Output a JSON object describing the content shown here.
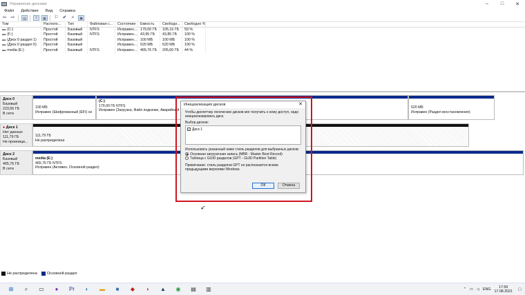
{
  "window": {
    "title": "Управление дисками"
  },
  "menu": [
    "Файл",
    "Действие",
    "Вид",
    "Справка"
  ],
  "volumes": {
    "columns": [
      "Том",
      "Располо...",
      "Тип",
      "Файловая с...",
      "Состояние",
      "Емкость",
      "Свободн...",
      "Свободно %"
    ],
    "rows": [
      [
        "(C:)",
        "Простой",
        "Базовый",
        "NTFS",
        "Исправен...",
        "179,00 ГБ",
        "105,16 ГБ",
        "59 %"
      ],
      [
        "(F:)",
        "Простой",
        "Базовый",
        "NTFS",
        "Исправен...",
        "43,95 ГБ",
        "43,85 ГБ",
        "100 %"
      ],
      [
        "(Диск 0 раздел 1)",
        "Простой",
        "Базовый",
        "",
        "Исправен...",
        "100 МБ",
        "100 МБ",
        "100 %"
      ],
      [
        "(Диск 0 раздел 5)",
        "Простой",
        "Базовый",
        "",
        "Исправен...",
        "520 МБ",
        "520 МБ",
        "100 %"
      ],
      [
        "media (E:)",
        "Простой",
        "Базовый",
        "NTFS",
        "Исправен...",
        "465,76 ГБ",
        "205,60 ГБ",
        "44 %"
      ]
    ]
  },
  "disks": {
    "disk0": {
      "name": "Диск 0",
      "type": "Базовый",
      "size": "223,56 ГБ",
      "status": "В сети",
      "p1_size": "100 МБ",
      "p1_status": "Исправен (Шифрованный (EFI) си",
      "p2_name": "(C:)",
      "p2_size": "179,00 ГБ NTFS",
      "p2_status": "Исправен (Загрузка, Файл подкачки, Аварийный",
      "p5_size": "520 МБ",
      "p5_status": "Исправен (Раздел восстановления)"
    },
    "disk1": {
      "name": "Диск 1",
      "type": "Нет данных",
      "size": "111,79 ГБ",
      "status": "Не проиници...",
      "p_size": "111,79 ГБ",
      "p_status": "Не распределена"
    },
    "disk2": {
      "name": "Диск 2",
      "type": "Базовый",
      "size": "465,76 ГБ",
      "status": "В сети",
      "p_name": "media (E:)",
      "p_size": "465,76 ГБ NTFS",
      "p_status": "Исправен (Активен, Основной раздел)"
    }
  },
  "legend": {
    "unallocated": "Не распределена",
    "primary": "Основной раздел"
  },
  "dialog": {
    "title": "Инициализация дисков",
    "intro": "Чтобы диспетчер логических дисков мог получить к нему доступ, надо инициализировать диск.",
    "select_label": "Выбор дисков:",
    "disk_item": "Диск 1",
    "style_label": "Использовать указанный ниже стиль разделов для выбранных дисков:",
    "mbr": "Основная загрузочная запись (MBR - Master Boot Record)",
    "gpt": "Таблица с GUID разделов (GPT - GUID Partition Table)",
    "note": "Примечание: стиль разделов GPT не распознается всеми предыдущими версиями Windows.",
    "ok": "ОК",
    "cancel": "Отмена"
  },
  "taskbar": {
    "lang": "ENG",
    "time": "17:50",
    "date": "17.08.2021"
  },
  "colors": {
    "primary_partition": "#0a2a8c",
    "unallocated": "#111111",
    "highlight_box": "#d0131f"
  }
}
